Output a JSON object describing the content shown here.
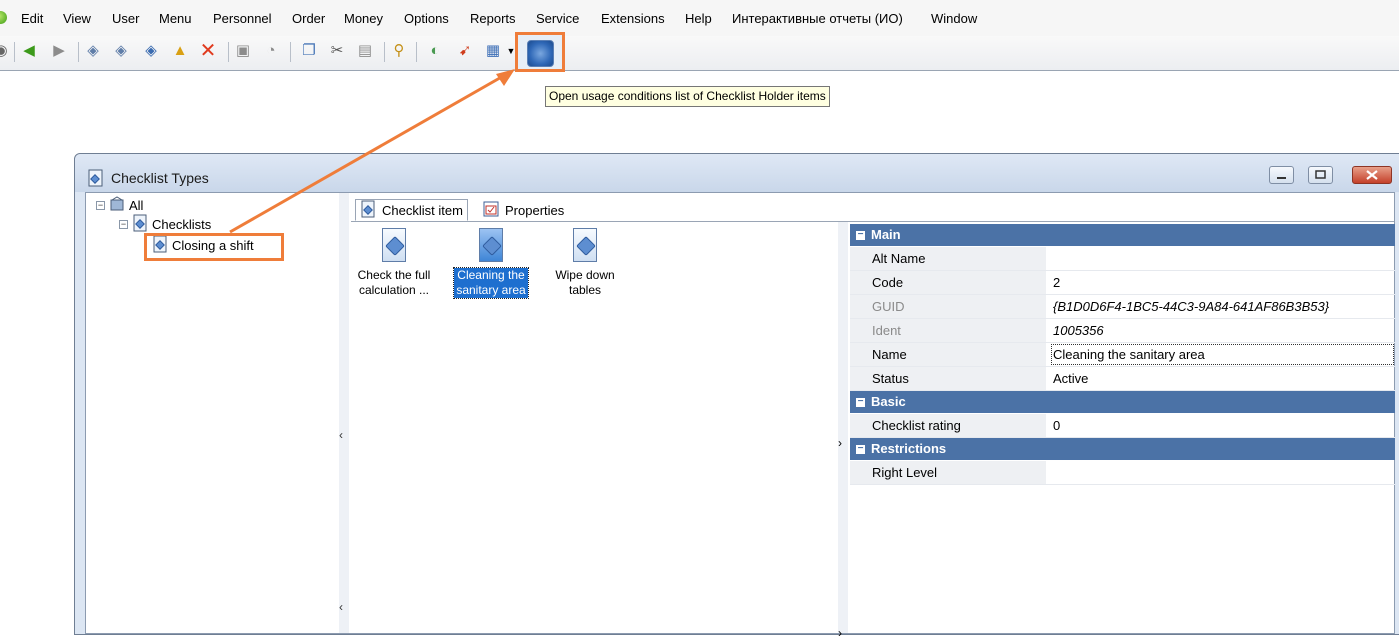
{
  "menu": {
    "items": [
      "Edit",
      "View",
      "User",
      "Menu",
      "Personnel",
      "Order",
      "Money",
      "Options",
      "Reports",
      "Service",
      "Extensions",
      "Help",
      "Интерактивные отчеты (ИО)",
      "Window"
    ]
  },
  "toolbar": {
    "icons": [
      "refresh-icon",
      "back-icon",
      "forward-icon",
      "new-item-icon",
      "new-group-icon",
      "edit-icon",
      "export-icon",
      "delete-icon",
      "save-icon",
      "undo-icon",
      "copy-icon",
      "cut-icon",
      "paste-icon",
      "search-icon",
      "filter-icon",
      "move-icon",
      "view-mode-icon",
      "usage-conditions-icon"
    ],
    "tooltip": "Open usage conditions list of Checklist Holder items"
  },
  "window": {
    "title": "Checklist Types"
  },
  "tree": {
    "root": "All",
    "group": "Checklists",
    "item": "Closing a shift"
  },
  "tabs": {
    "checklist_item": "Checklist item",
    "properties": "Properties"
  },
  "items": [
    {
      "label_line1": "Check the full",
      "label_line2": "calculation ..."
    },
    {
      "label_line1": "Cleaning the",
      "label_line2": "sanitary area"
    },
    {
      "label_line1": "Wipe down",
      "label_line2": "tables"
    }
  ],
  "properties": {
    "main_label": "Main",
    "basic_label": "Basic",
    "restrictions_label": "Restrictions",
    "rows": {
      "alt_name": {
        "name": "Alt Name",
        "value": ""
      },
      "code": {
        "name": "Code",
        "value": "2"
      },
      "guid": {
        "name": "GUID",
        "value": "{B1D0D6F4-1BC5-44C3-9A84-641AF86B3B53}"
      },
      "ident": {
        "name": "Ident",
        "value": "1005356"
      },
      "name": {
        "name": "Name",
        "value": "Cleaning the sanitary area"
      },
      "status": {
        "name": "Status",
        "value": "Active"
      },
      "checklist_rating": {
        "name": "Checklist rating",
        "value": "0"
      },
      "right_level": {
        "name": "Right Level",
        "value": ""
      }
    }
  },
  "colors": {
    "accent_highlight": "#ef7d3a",
    "section_header": "#4b72a6",
    "selection": "#1e6fcf"
  }
}
